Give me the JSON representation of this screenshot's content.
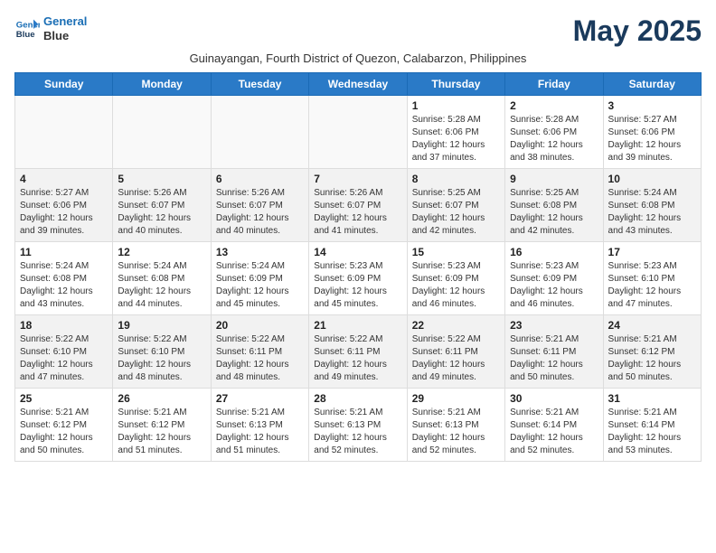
{
  "header": {
    "logo_line1": "General",
    "logo_line2": "Blue",
    "month_title": "May 2025",
    "subtitle": "Guinayangan, Fourth District of Quezon, Calabarzon, Philippines"
  },
  "weekdays": [
    "Sunday",
    "Monday",
    "Tuesday",
    "Wednesday",
    "Thursday",
    "Friday",
    "Saturday"
  ],
  "weeks": [
    [
      {
        "day": "",
        "info": "",
        "empty": true
      },
      {
        "day": "",
        "info": "",
        "empty": true
      },
      {
        "day": "",
        "info": "",
        "empty": true
      },
      {
        "day": "",
        "info": "",
        "empty": true
      },
      {
        "day": "1",
        "info": "Sunrise: 5:28 AM\nSunset: 6:06 PM\nDaylight: 12 hours\nand 37 minutes.",
        "empty": false
      },
      {
        "day": "2",
        "info": "Sunrise: 5:28 AM\nSunset: 6:06 PM\nDaylight: 12 hours\nand 38 minutes.",
        "empty": false
      },
      {
        "day": "3",
        "info": "Sunrise: 5:27 AM\nSunset: 6:06 PM\nDaylight: 12 hours\nand 39 minutes.",
        "empty": false
      }
    ],
    [
      {
        "day": "4",
        "info": "Sunrise: 5:27 AM\nSunset: 6:06 PM\nDaylight: 12 hours\nand 39 minutes.",
        "empty": false,
        "shaded": true
      },
      {
        "day": "5",
        "info": "Sunrise: 5:26 AM\nSunset: 6:07 PM\nDaylight: 12 hours\nand 40 minutes.",
        "empty": false,
        "shaded": true
      },
      {
        "day": "6",
        "info": "Sunrise: 5:26 AM\nSunset: 6:07 PM\nDaylight: 12 hours\nand 40 minutes.",
        "empty": false,
        "shaded": true
      },
      {
        "day": "7",
        "info": "Sunrise: 5:26 AM\nSunset: 6:07 PM\nDaylight: 12 hours\nand 41 minutes.",
        "empty": false,
        "shaded": true
      },
      {
        "day": "8",
        "info": "Sunrise: 5:25 AM\nSunset: 6:07 PM\nDaylight: 12 hours\nand 42 minutes.",
        "empty": false,
        "shaded": true
      },
      {
        "day": "9",
        "info": "Sunrise: 5:25 AM\nSunset: 6:08 PM\nDaylight: 12 hours\nand 42 minutes.",
        "empty": false,
        "shaded": true
      },
      {
        "day": "10",
        "info": "Sunrise: 5:24 AM\nSunset: 6:08 PM\nDaylight: 12 hours\nand 43 minutes.",
        "empty": false,
        "shaded": true
      }
    ],
    [
      {
        "day": "11",
        "info": "Sunrise: 5:24 AM\nSunset: 6:08 PM\nDaylight: 12 hours\nand 43 minutes.",
        "empty": false
      },
      {
        "day": "12",
        "info": "Sunrise: 5:24 AM\nSunset: 6:08 PM\nDaylight: 12 hours\nand 44 minutes.",
        "empty": false
      },
      {
        "day": "13",
        "info": "Sunrise: 5:24 AM\nSunset: 6:09 PM\nDaylight: 12 hours\nand 45 minutes.",
        "empty": false
      },
      {
        "day": "14",
        "info": "Sunrise: 5:23 AM\nSunset: 6:09 PM\nDaylight: 12 hours\nand 45 minutes.",
        "empty": false
      },
      {
        "day": "15",
        "info": "Sunrise: 5:23 AM\nSunset: 6:09 PM\nDaylight: 12 hours\nand 46 minutes.",
        "empty": false
      },
      {
        "day": "16",
        "info": "Sunrise: 5:23 AM\nSunset: 6:09 PM\nDaylight: 12 hours\nand 46 minutes.",
        "empty": false
      },
      {
        "day": "17",
        "info": "Sunrise: 5:23 AM\nSunset: 6:10 PM\nDaylight: 12 hours\nand 47 minutes.",
        "empty": false
      }
    ],
    [
      {
        "day": "18",
        "info": "Sunrise: 5:22 AM\nSunset: 6:10 PM\nDaylight: 12 hours\nand 47 minutes.",
        "empty": false,
        "shaded": true
      },
      {
        "day": "19",
        "info": "Sunrise: 5:22 AM\nSunset: 6:10 PM\nDaylight: 12 hours\nand 48 minutes.",
        "empty": false,
        "shaded": true
      },
      {
        "day": "20",
        "info": "Sunrise: 5:22 AM\nSunset: 6:11 PM\nDaylight: 12 hours\nand 48 minutes.",
        "empty": false,
        "shaded": true
      },
      {
        "day": "21",
        "info": "Sunrise: 5:22 AM\nSunset: 6:11 PM\nDaylight: 12 hours\nand 49 minutes.",
        "empty": false,
        "shaded": true
      },
      {
        "day": "22",
        "info": "Sunrise: 5:22 AM\nSunset: 6:11 PM\nDaylight: 12 hours\nand 49 minutes.",
        "empty": false,
        "shaded": true
      },
      {
        "day": "23",
        "info": "Sunrise: 5:21 AM\nSunset: 6:11 PM\nDaylight: 12 hours\nand 50 minutes.",
        "empty": false,
        "shaded": true
      },
      {
        "day": "24",
        "info": "Sunrise: 5:21 AM\nSunset: 6:12 PM\nDaylight: 12 hours\nand 50 minutes.",
        "empty": false,
        "shaded": true
      }
    ],
    [
      {
        "day": "25",
        "info": "Sunrise: 5:21 AM\nSunset: 6:12 PM\nDaylight: 12 hours\nand 50 minutes.",
        "empty": false
      },
      {
        "day": "26",
        "info": "Sunrise: 5:21 AM\nSunset: 6:12 PM\nDaylight: 12 hours\nand 51 minutes.",
        "empty": false
      },
      {
        "day": "27",
        "info": "Sunrise: 5:21 AM\nSunset: 6:13 PM\nDaylight: 12 hours\nand 51 minutes.",
        "empty": false
      },
      {
        "day": "28",
        "info": "Sunrise: 5:21 AM\nSunset: 6:13 PM\nDaylight: 12 hours\nand 52 minutes.",
        "empty": false
      },
      {
        "day": "29",
        "info": "Sunrise: 5:21 AM\nSunset: 6:13 PM\nDaylight: 12 hours\nand 52 minutes.",
        "empty": false
      },
      {
        "day": "30",
        "info": "Sunrise: 5:21 AM\nSunset: 6:14 PM\nDaylight: 12 hours\nand 52 minutes.",
        "empty": false
      },
      {
        "day": "31",
        "info": "Sunrise: 5:21 AM\nSunset: 6:14 PM\nDaylight: 12 hours\nand 53 minutes.",
        "empty": false
      }
    ]
  ]
}
